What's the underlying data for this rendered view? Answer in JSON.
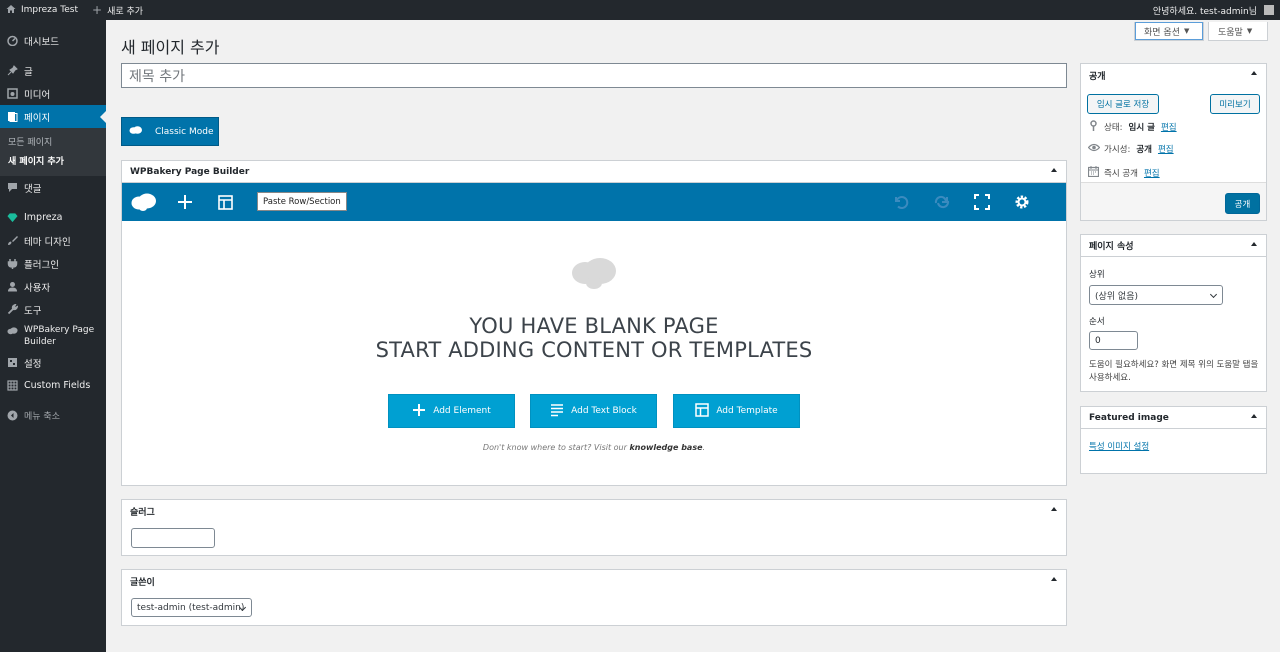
{
  "adminbar": {
    "site_name": "Impreza Test",
    "new_label": "새로 추가",
    "greeting": "안녕하세요. test-admin님"
  },
  "sidebar": {
    "items": [
      {
        "label": "대시보드",
        "icon": "dashboard-icon"
      },
      {
        "label": "글",
        "icon": "pin-icon"
      },
      {
        "label": "미디어",
        "icon": "media-icon"
      },
      {
        "label": "페이지",
        "icon": "page-icon"
      },
      {
        "label": "댓글",
        "icon": "comment-icon"
      },
      {
        "label": "Impreza",
        "icon": "diamond-icon"
      },
      {
        "label": "테마 디자인",
        "icon": "brush-icon"
      },
      {
        "label": "플러그인",
        "icon": "plugin-icon"
      },
      {
        "label": "사용자",
        "icon": "user-icon"
      },
      {
        "label": "도구",
        "icon": "wrench-icon"
      },
      {
        "label": "WPBakery Page Builder",
        "label_line1": "WPBakery Page",
        "label_line2": "Builder",
        "icon": "cloud-icon"
      },
      {
        "label": "설정",
        "icon": "settings-icon"
      },
      {
        "label": "Custom Fields",
        "icon": "grid-icon"
      },
      {
        "label": "메뉴 축소",
        "icon": "collapse-icon"
      }
    ],
    "submenu": [
      "모든 페이지",
      "새 페이지 추가"
    ]
  },
  "header": {
    "title": "새 페이지 추가",
    "screen_options": "화면 옵션",
    "help": "도움말"
  },
  "editor": {
    "title_placeholder": "제목 추가",
    "classic_mode": "Classic Mode"
  },
  "wpbakery": {
    "title": "WPBakery Page Builder",
    "paste_tooltip": "Paste Row/Section",
    "blank_line1": "YOU HAVE BLANK PAGE",
    "blank_line2": "START ADDING CONTENT OR TEMPLATES",
    "add_element": "Add Element",
    "add_text_block": "Add Text Block",
    "add_template": "Add Template",
    "kb_prefix": "Don't know where to start? Visit our ",
    "kb_link": "knowledge base",
    "kb_suffix": "."
  },
  "slug": {
    "title": "슬러그",
    "value": ""
  },
  "author": {
    "title": "글쓴이",
    "value": "test-admin (test-admin)"
  },
  "publish": {
    "title": "공개",
    "save_draft": "임시 글로 저장",
    "preview": "미리보기",
    "status_label": "상태:",
    "status_value": "임시 글",
    "visibility_label": "가시성:",
    "visibility_value": "공개",
    "schedule_label": "즉시 공개",
    "edit": "편집",
    "publish_button": "공개"
  },
  "page_attributes": {
    "title": "페이지 속성",
    "parent_label": "상위",
    "parent_value": "(상위 없음)",
    "order_label": "순서",
    "order_value": "0",
    "help_text": "도움이 필요하세요? 화면 제목 위의 도움말 탭을 사용하세요."
  },
  "featured_image": {
    "title": "Featured image",
    "set_link": "특성 이미지 설정"
  },
  "colors": {
    "admin_dark": "#23282d",
    "accent_blue": "#0073aa",
    "vc_button": "#00a0d2"
  }
}
